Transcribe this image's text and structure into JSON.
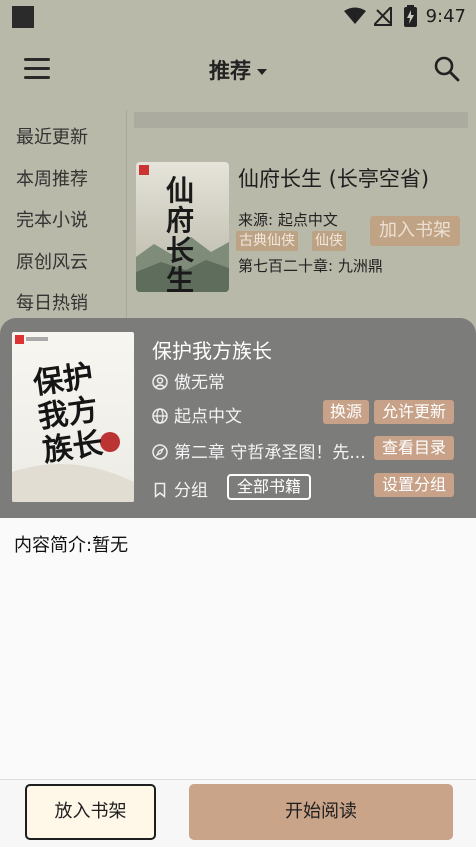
{
  "status_bar": {
    "time": "9:47"
  },
  "app_bar": {
    "title": "推荐"
  },
  "sidebar": {
    "items": [
      "最近更新",
      "本周推荐",
      "完本小说",
      "原创风云",
      "每日热销"
    ]
  },
  "book1": {
    "title": "仙府长生 (长亭空省)",
    "source": "来源: 起点中文",
    "tags": [
      "古典仙侠",
      "仙侠"
    ],
    "add_label": "加入书架",
    "latest": "第七百二十章: 九洲鼎",
    "cover_text": "仙府长生"
  },
  "dialog": {
    "cover_text": "保护我方族长",
    "title": "保护我方族长",
    "author": "傲无常",
    "source": "起点中文",
    "switch_source": "换源",
    "allow_update": "允许更新",
    "chapter": "第二章 守哲承圣图！先...",
    "view_toc": "查看目录",
    "group_label": "分组",
    "group_value": "全部书籍",
    "set_group": "设置分组",
    "description": "内容简介:暂无"
  },
  "footer": {
    "add_shelf": "放入书架",
    "start_reading": "开始阅读"
  },
  "colors": {
    "accent": "#c9a489",
    "scrim": "#b9b9a9",
    "dialog_header": "#7c7c7b"
  }
}
